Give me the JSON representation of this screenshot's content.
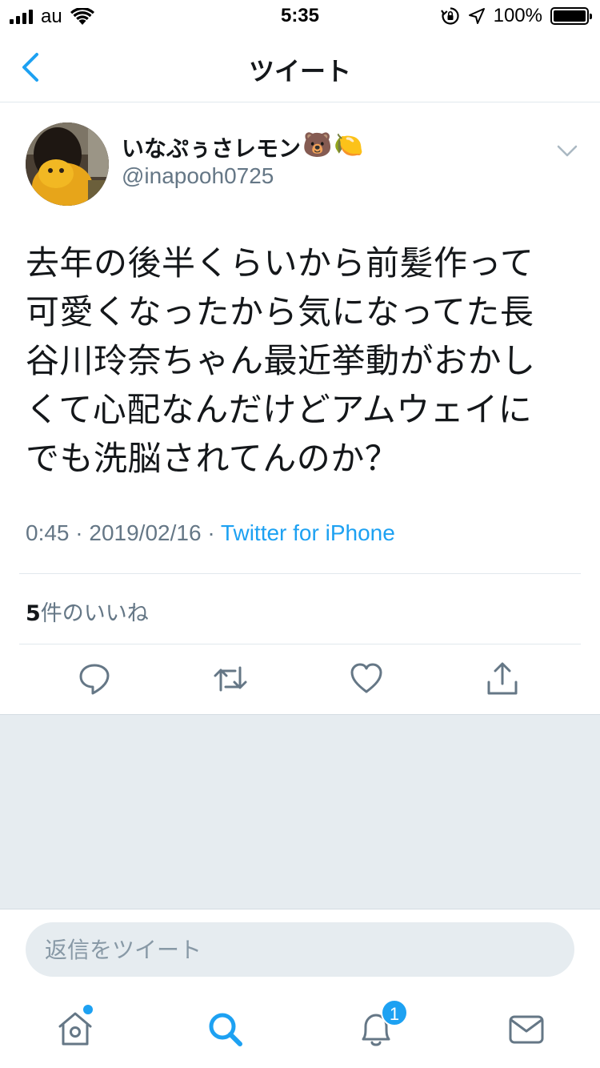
{
  "status_bar": {
    "carrier": "au",
    "time": "5:35",
    "battery_percent": "100%",
    "battery_level": 1.0,
    "signal_bars": 4
  },
  "nav": {
    "title": "ツイート"
  },
  "tweet": {
    "author_name": "いなぷぅさレモン",
    "author_emoji": [
      "🐻",
      "🍋"
    ],
    "author_handle": "@inapooh0725",
    "text_lines": [
      "去年の後半くらいから前髪作って",
      "可愛くなったから気になってた長",
      "谷川玲奈ちゃん最近挙動がおかし",
      "くて心配なんだけどアムウェイに",
      "でも洗脳されてんのか？"
    ],
    "time": "0:45",
    "date": "2019/02/16",
    "separator": "·",
    "source": "Twitter for iPhone",
    "likes_count": "5",
    "likes_label": "件のいいね"
  },
  "reply": {
    "placeholder": "返信をツイート"
  },
  "tabbar": {
    "notifications_badge": "1"
  },
  "colors": {
    "accent": "#1da1f2",
    "secondary_text": "#657786",
    "divider": "#e1e8ed",
    "background_gray": "#e6ecf0"
  }
}
